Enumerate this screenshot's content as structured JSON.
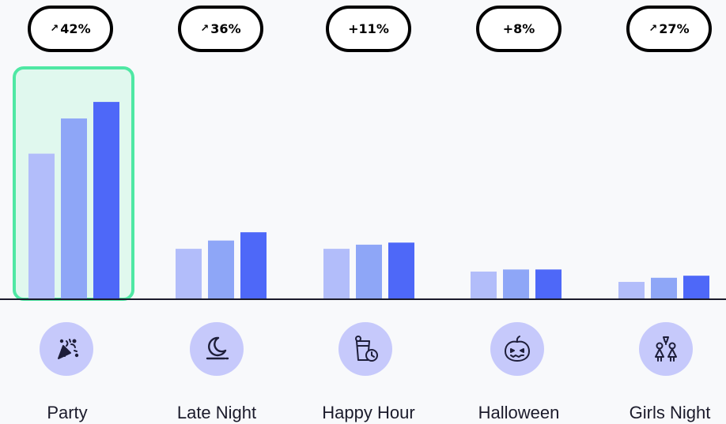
{
  "chart_data": {
    "type": "bar",
    "categories": [
      "Party",
      "Late Night",
      "Happy Hour",
      "Halloween",
      "Girls Night"
    ],
    "series": [
      {
        "values": [
          70,
          24,
          24,
          13,
          8
        ]
      },
      {
        "values": [
          87,
          28,
          26,
          14,
          10
        ]
      },
      {
        "values": [
          95,
          32,
          27,
          14,
          11
        ]
      }
    ],
    "changes": [
      {
        "arrow": "↗",
        "value": "42%",
        "trend": "up"
      },
      {
        "arrow": "↗",
        "value": "36%",
        "trend": "up"
      },
      {
        "arrow": "",
        "value": "+11%",
        "trend": "flat"
      },
      {
        "arrow": "",
        "value": "+8%",
        "trend": "flat"
      },
      {
        "arrow": "↗",
        "value": "27%",
        "trend": "up"
      }
    ],
    "highlighted_category": "Party",
    "ylim": [
      0,
      100
    ],
    "grid": false,
    "legend": "none"
  },
  "icons": [
    "party-popper-icon",
    "moon-icon",
    "drink-clock-icon",
    "pumpkin-icon",
    "girls-toast-icon"
  ],
  "colors": {
    "series": [
      "#b2bdfa",
      "#8ea6f7",
      "#4e68f8"
    ],
    "highlight_fill": "#e0f8ee",
    "highlight_border": "#4fe8a4",
    "up": "#11b461",
    "flat": "#777777",
    "icon_bg": "#c6c9fb",
    "icon_fg": "#1e1e3a",
    "baseline": "#1b1b2b"
  }
}
